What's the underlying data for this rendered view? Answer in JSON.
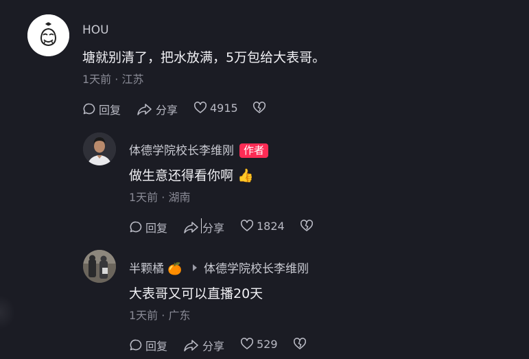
{
  "comments": {
    "main": {
      "username": "HOU",
      "text": "塘就别清了，把水放满，5万包给大表哥。",
      "meta": "1天前 · 江苏",
      "reply_label": "回复",
      "share_label": "分享",
      "likes": "4915"
    },
    "reply1": {
      "username": "体德学院校长李维刚",
      "badge": "作者",
      "text": "做生意还得看你啊",
      "emoji": "👍",
      "meta": "1天前 · 湖南",
      "reply_label": "回复",
      "share_label": "分享",
      "likes": "1824"
    },
    "reply2": {
      "username": "半颗橘",
      "username_emoji": "🍊",
      "reply_to": "体德学院校长李维刚",
      "text": "大表哥又可以直播20天",
      "meta": "1天前 · 广东",
      "reply_label": "回复",
      "share_label": "分享",
      "likes": "529"
    }
  },
  "icons": {
    "reply": "speech-bubble-icon",
    "share": "share-arrow-icon",
    "like": "heart-icon",
    "dislike": "broken-heart-icon"
  },
  "colors": {
    "background": "#1b1c24",
    "author_badge": "#fe2c55",
    "meta_text": "#8a8b96"
  }
}
